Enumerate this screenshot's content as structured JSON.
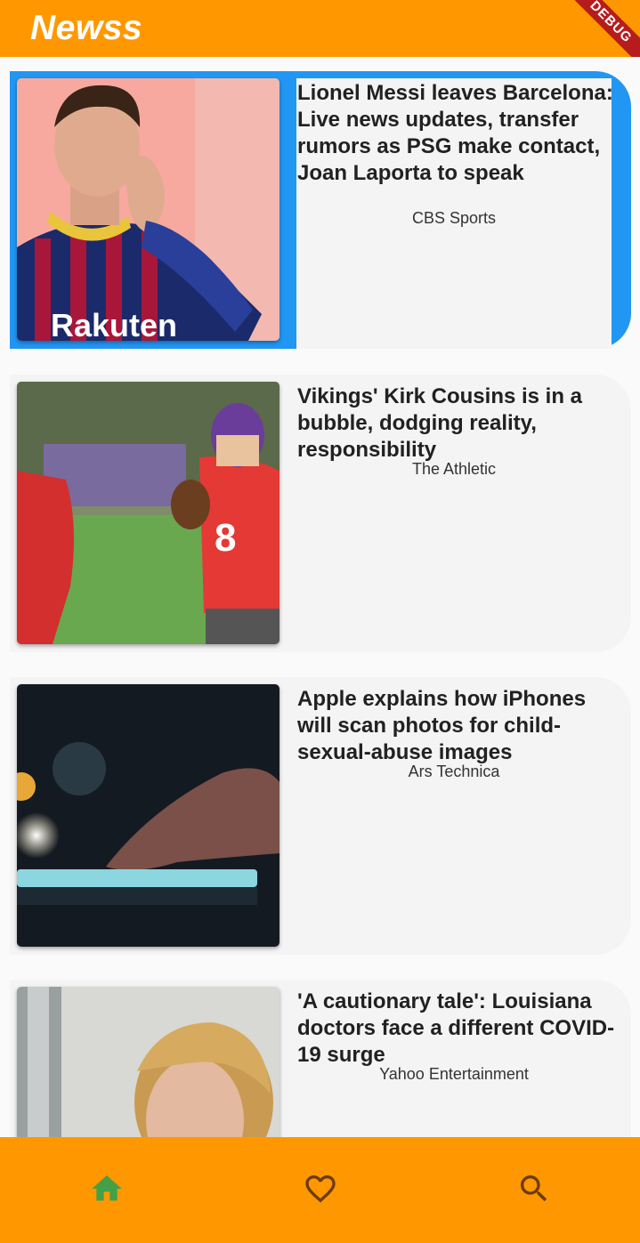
{
  "app": {
    "title": "Newss",
    "debug_banner": "DEBUG",
    "accent_color": "#ff9800",
    "selected_color": "#2196f3"
  },
  "articles": [
    {
      "title": "Lionel Messi leaves Barcelona: Live news updates, transfer rumors as PSG make contact, Joan Laporta to speak",
      "source": "CBS Sports",
      "selected": true
    },
    {
      "title": "Vikings' Kirk Cousins is in a bubble, dodging reality, responsibility",
      "source": "The Athletic",
      "selected": false
    },
    {
      "title": "Apple explains how iPhones will scan photos for child-sexual-abuse images",
      "source": "Ars Technica",
      "selected": false
    },
    {
      "title": "'A cautionary tale': Louisiana doctors face a different COVID-19 surge",
      "source": "Yahoo Entertainment",
      "selected": false
    }
  ],
  "bottom_nav": {
    "items": [
      {
        "icon": "home-icon",
        "active": true,
        "color": "#43a047"
      },
      {
        "icon": "heart-icon",
        "active": false,
        "color": "#6d3b0e"
      },
      {
        "icon": "search-icon",
        "active": false,
        "color": "#6d3b0e"
      }
    ]
  }
}
